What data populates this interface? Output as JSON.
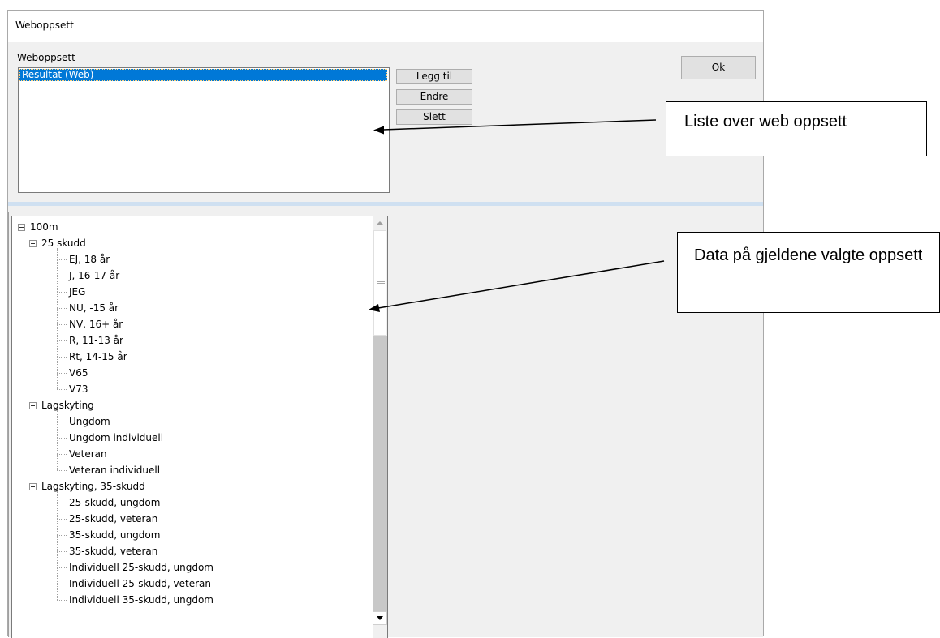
{
  "window": {
    "title": "Weboppsett"
  },
  "setups": {
    "group_label": "Weboppsett",
    "items": [
      "Resultat (Web)"
    ],
    "buttons": {
      "add": "Legg til",
      "edit": "Endre",
      "delete": "Slett",
      "ok": "Ok"
    }
  },
  "tree": {
    "root": "100m",
    "groups": [
      {
        "label": "25 skudd",
        "children": [
          "EJ, 18 år",
          "J, 16-17 år",
          "JEG",
          "NU, -15 år",
          "NV, 16+ år",
          "R, 11-13 år",
          "Rt, 14-15 år",
          "V65",
          "V73"
        ]
      },
      {
        "label": "Lagskyting",
        "children": [
          "Ungdom",
          "Ungdom individuell",
          "Veteran",
          "Veteran individuell"
        ]
      },
      {
        "label": "Lagskyting, 35-skudd",
        "children": [
          "25-skudd, ungdom",
          "25-skudd, veteran",
          "35-skudd, ungdom",
          "35-skudd, veteran",
          "Individuell 25-skudd, ungdom",
          "Individuell 25-skudd, veteran",
          "Individuell 35-skudd, ungdom"
        ]
      }
    ]
  },
  "callouts": {
    "list": "Liste over web oppsett",
    "data": "Data på gjeldene valgte oppsett"
  }
}
